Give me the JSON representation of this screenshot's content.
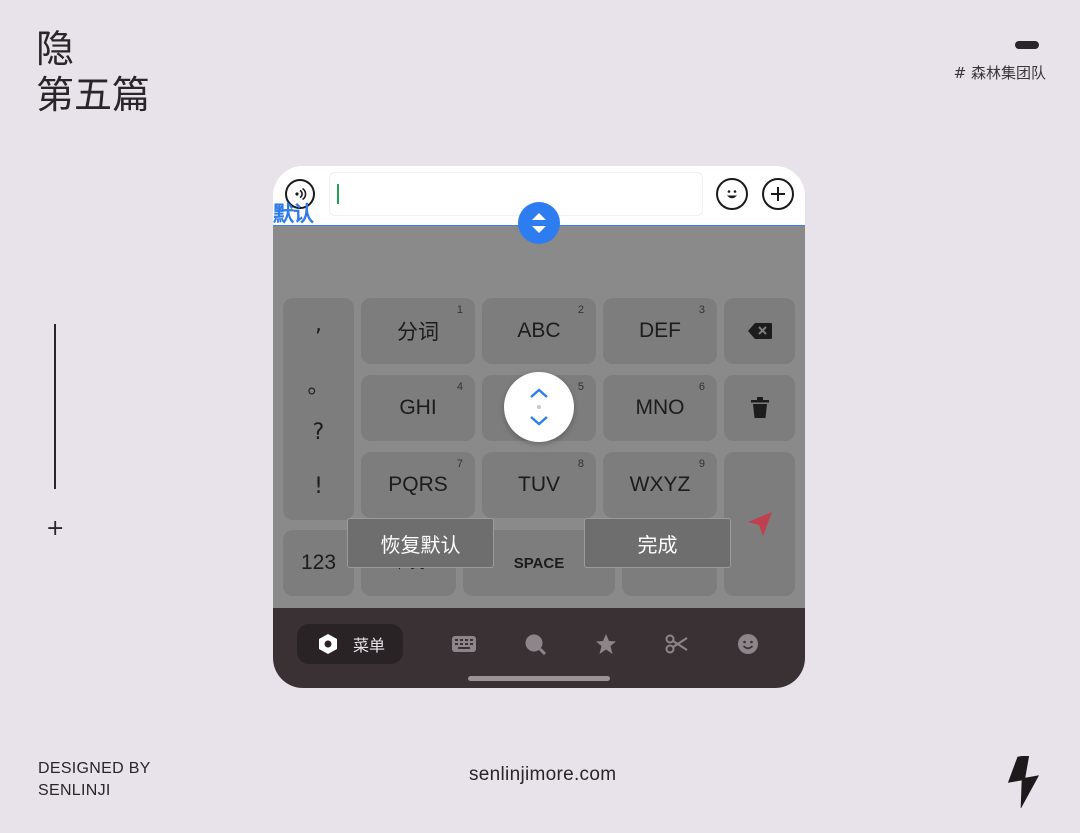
{
  "header": {
    "title_line1": "隐",
    "title_line2": "第五篇",
    "tag": "# 森林集团队"
  },
  "footer": {
    "designed_line1": "DESIGNED BY",
    "designed_line2": "SENLINJI",
    "site": "senlinjimore.com"
  },
  "phone": {
    "default_label": "默认",
    "input_value": "",
    "punctuation": [
      ",",
      "。",
      "?",
      "!"
    ],
    "keys_row1": [
      {
        "label": "分词",
        "num": "1"
      },
      {
        "label": "ABC",
        "num": "2"
      },
      {
        "label": "DEF",
        "num": "3"
      }
    ],
    "keys_row2": [
      {
        "label": "GHI",
        "num": "4"
      },
      {
        "label": "",
        "num": "5"
      },
      {
        "label": "MNO",
        "num": "6"
      }
    ],
    "keys_row3": [
      {
        "label": "PQRS",
        "num": "7"
      },
      {
        "label": "TUV",
        "num": "8"
      },
      {
        "label": "WXYZ",
        "num": "9"
      }
    ],
    "key_123": "123",
    "key_lang": "中/英",
    "key_space": "SPACE",
    "restore_button": "恢复默认",
    "done_button": "完成",
    "bottom_menu_label": "菜单",
    "icons": {
      "voice": "voice-icon",
      "emoji": "emoji-icon",
      "add": "plus-icon",
      "backspace": "backspace-icon",
      "trash": "trash-icon",
      "send": "send-icon",
      "menu": "hexagon-icon",
      "keyboard": "keyboard-icon",
      "search": "search-icon",
      "star": "star-icon",
      "scissors": "scissors-icon",
      "smile": "smile-icon"
    },
    "colors": {
      "accent_blue": "#2e7df0",
      "send_red": "#c0404f",
      "caret_green": "#1fa05c"
    }
  }
}
